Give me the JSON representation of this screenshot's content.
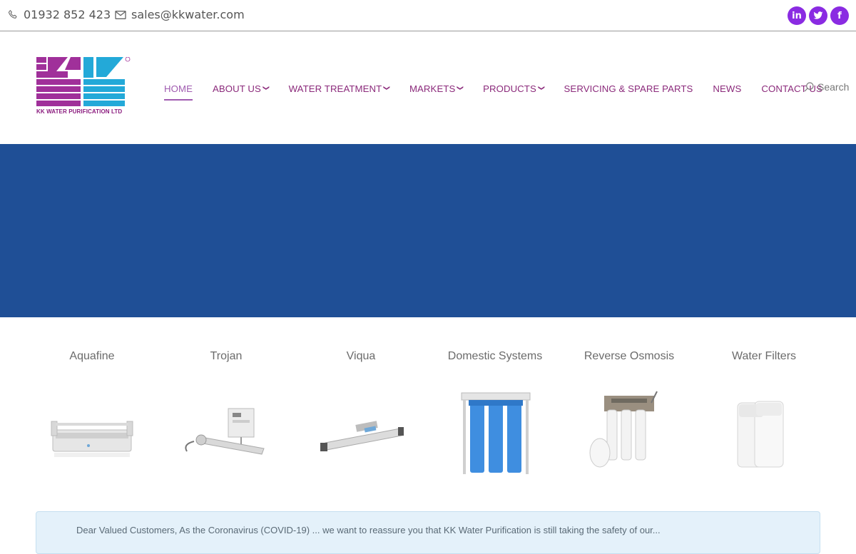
{
  "topbar": {
    "phone": "01932 852 423",
    "email": "sales@kkwater.com",
    "socials": [
      {
        "name": "linkedin",
        "glyph": "in"
      },
      {
        "name": "twitter",
        "glyph": "t"
      },
      {
        "name": "facebook",
        "glyph": "f"
      }
    ]
  },
  "logo": {
    "company": "KK WATER PURIFICATION LTD",
    "registered_mark": "®",
    "brand_colors": [
      "#a0309a",
      "#23a9d8"
    ]
  },
  "nav": {
    "items": [
      {
        "label": "HOME",
        "active": true,
        "dropdown": false
      },
      {
        "label": "ABOUT US",
        "active": false,
        "dropdown": true
      },
      {
        "label": "WATER TREATMENT",
        "active": false,
        "dropdown": true
      },
      {
        "label": "MARKETS",
        "active": false,
        "dropdown": true
      },
      {
        "label": "PRODUCTS",
        "active": false,
        "dropdown": true
      },
      {
        "label": "SERVICING & SPARE PARTS",
        "active": false,
        "dropdown": false
      },
      {
        "label": "NEWS",
        "active": false,
        "dropdown": false
      },
      {
        "label": "CONTACT US",
        "active": false,
        "dropdown": false
      }
    ],
    "search_label": "Search"
  },
  "banner": {
    "color": "#1f4f96"
  },
  "products": [
    {
      "title": "Aquafine",
      "icon": "uv-system-image"
    },
    {
      "title": "Trojan",
      "icon": "uv-chamber-image"
    },
    {
      "title": "Viqua",
      "icon": "uv-steriliser-image"
    },
    {
      "title": "Domestic Systems",
      "icon": "blue-filter-housings-image"
    },
    {
      "title": "Reverse Osmosis",
      "icon": "ro-unit-image"
    },
    {
      "title": "Water Filters",
      "icon": "water-softener-image"
    }
  ],
  "notice": {
    "text": "Dear Valued Customers, As the Coronavirus (COVID-19) ... we want to reassure you that KK Water Purification is still taking the safety of our..."
  }
}
